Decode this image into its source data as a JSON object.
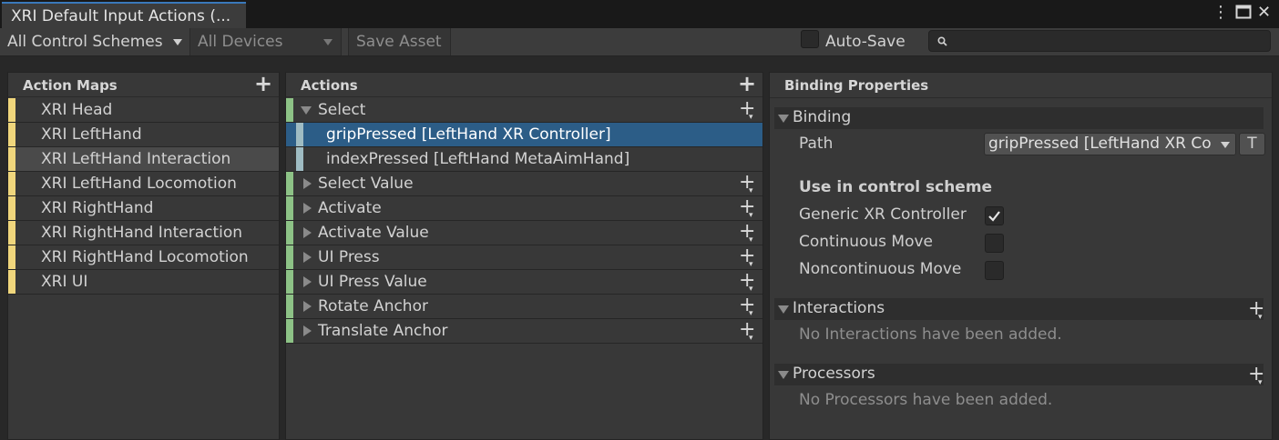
{
  "window": {
    "tab_title": "XRI Default Input Actions (..."
  },
  "toolbar": {
    "control_scheme": "All Control Schemes",
    "devices": "All Devices",
    "save_asset": "Save Asset",
    "auto_save_label": "Auto-Save",
    "auto_save_checked": false,
    "search_placeholder": ""
  },
  "action_maps": {
    "header": "Action Maps",
    "items": [
      {
        "label": "XRI Head"
      },
      {
        "label": "XRI LeftHand"
      },
      {
        "label": "XRI LeftHand Interaction",
        "selected": true
      },
      {
        "label": "XRI LeftHand Locomotion"
      },
      {
        "label": "XRI RightHand"
      },
      {
        "label": "XRI RightHand Interaction"
      },
      {
        "label": "XRI RightHand Locomotion"
      },
      {
        "label": "XRI UI"
      }
    ]
  },
  "actions": {
    "header": "Actions",
    "items": [
      {
        "label": "Select",
        "expanded": true
      },
      {
        "label": "gripPressed [LeftHand XR Controller]",
        "binding": true,
        "selected": true
      },
      {
        "label": "indexPressed [LeftHand MetaAimHand]",
        "binding": true
      },
      {
        "label": "Select Value"
      },
      {
        "label": "Activate"
      },
      {
        "label": "Activate Value"
      },
      {
        "label": "UI Press"
      },
      {
        "label": "UI Press Value"
      },
      {
        "label": "Rotate Anchor"
      },
      {
        "label": "Translate Anchor"
      }
    ]
  },
  "binding_properties": {
    "header": "Binding Properties",
    "binding_section": "Binding",
    "path_label": "Path",
    "path_value": "gripPressed [LeftHand XR Co",
    "t_button": "T",
    "control_scheme_title": "Use in control scheme",
    "schemes": [
      {
        "label": "Generic XR Controller",
        "checked": true
      },
      {
        "label": "Continuous Move",
        "checked": false
      },
      {
        "label": "Noncontinuous Move",
        "checked": false
      }
    ],
    "interactions_section": "Interactions",
    "interactions_empty": "No Interactions have been added.",
    "processors_section": "Processors",
    "processors_empty": "No Processors have been added."
  },
  "colors": {
    "accent_blue": "#2c5d87",
    "tab_highlight": "#3a79bb",
    "action_map_stripe": "#f0d67c",
    "action_stripe": "#8dc286",
    "binding_stripe": "#9fbcc3"
  }
}
